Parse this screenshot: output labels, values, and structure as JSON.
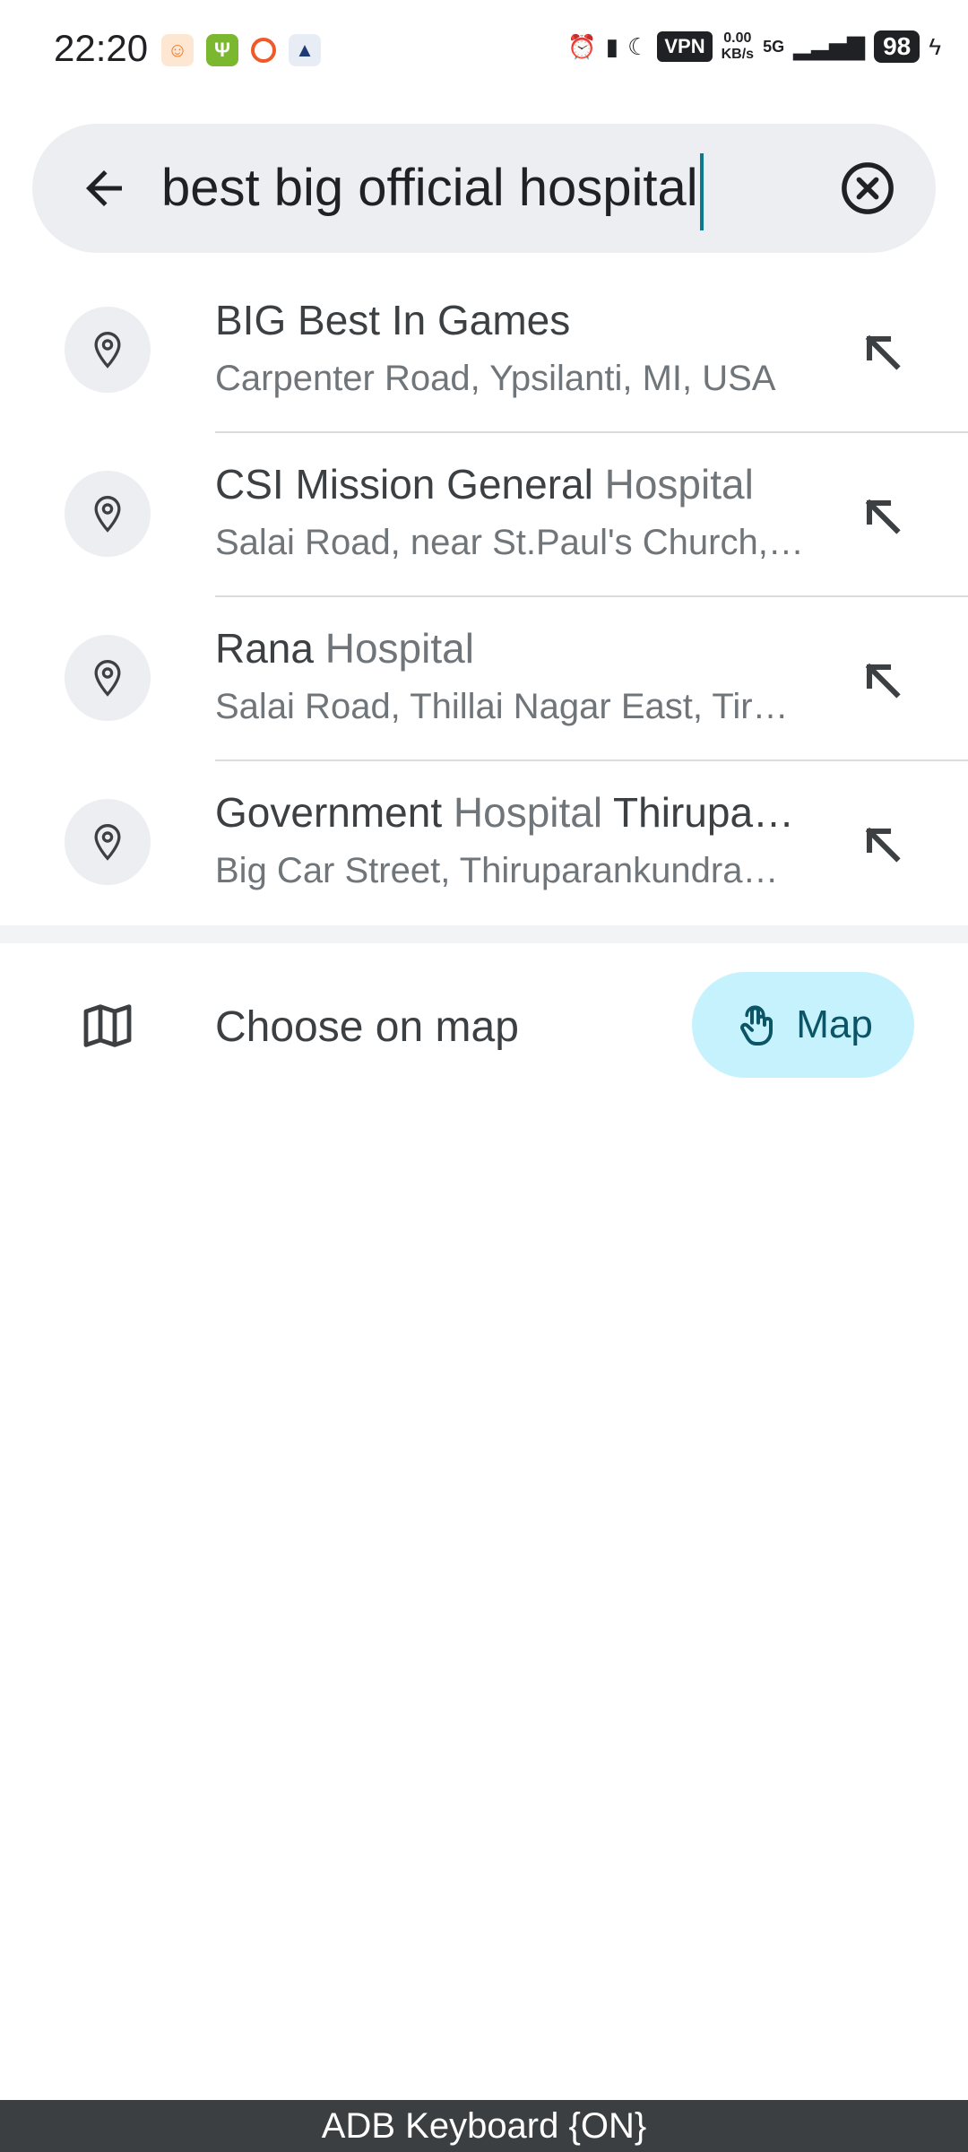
{
  "status_bar": {
    "time": "22:20",
    "vpn": "VPN",
    "net_speed_value": "0.00",
    "net_speed_unit": "KB/s",
    "network": "5G",
    "battery": "98"
  },
  "search": {
    "query": "best big official hospital"
  },
  "suggestions": [
    {
      "title_parts": [
        {
          "text": "BIG Best In Games",
          "hl": false
        }
      ],
      "subtitle": "Carpenter Road, Ypsilanti, MI, USA"
    },
    {
      "title_parts": [
        {
          "text": "CSI Mission General ",
          "hl": false
        },
        {
          "text": "Hospital",
          "hl": true
        }
      ],
      "subtitle": "Salai Road, near St.Paul's Church, Tiruchirappalli"
    },
    {
      "title_parts": [
        {
          "text": "Rana ",
          "hl": false
        },
        {
          "text": "Hospital",
          "hl": true
        }
      ],
      "subtitle": "Salai Road, Thillai Nagar East, Tiruchirappalli"
    },
    {
      "title_parts": [
        {
          "text": "Government ",
          "hl": false
        },
        {
          "text": "Hospital",
          "hl": true
        },
        {
          "text": " Thiruparankundram",
          "hl": false
        }
      ],
      "subtitle": "Big Car Street, Thiruparankundram, Madurai"
    }
  ],
  "choose_on_map": {
    "label": "Choose on map",
    "button_label": "Map"
  },
  "keyboard_banner": "ADB Keyboard {ON}"
}
